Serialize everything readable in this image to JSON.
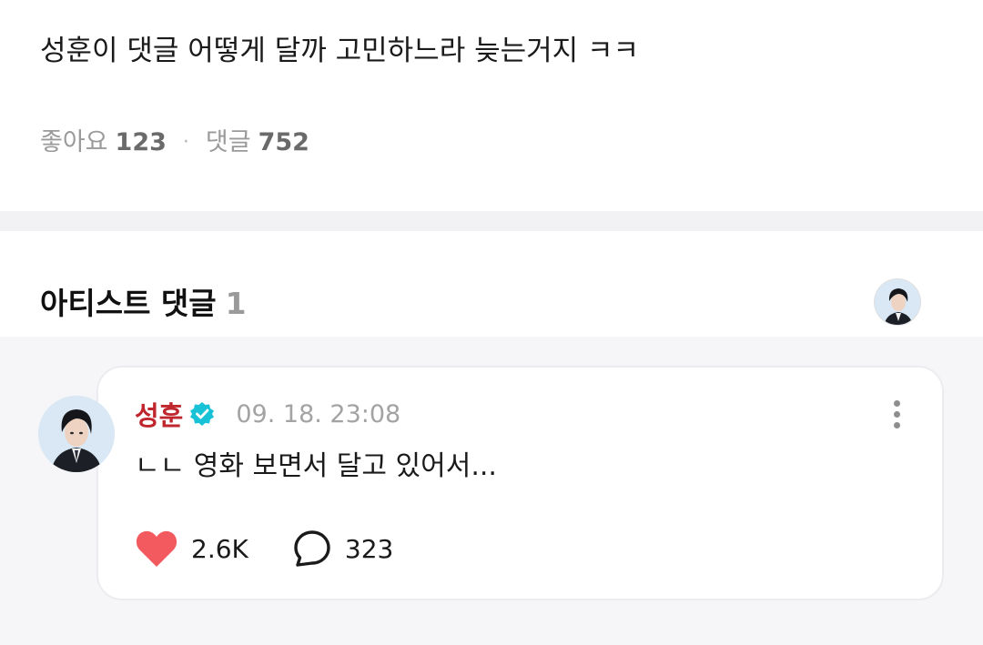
{
  "post": {
    "text": "성훈이 댓글 어떻게 달까 고민하느라 늦는거지 ㅋㅋ",
    "likes_label": "좋아요",
    "likes_count": "123",
    "separator": "·",
    "comments_label": "댓글",
    "comments_count": "752"
  },
  "artist_comments": {
    "title": "아티스트 댓글",
    "count": "1"
  },
  "comment": {
    "author": "성훈",
    "timestamp": "09. 18. 23:08",
    "text": "ㄴㄴ 영화 보면서 달고 있어서...",
    "like_count": "2.6K",
    "reply_count": "323"
  },
  "icons": {
    "verified": "verified-badge-icon",
    "more": "more-vertical-icon",
    "like": "heart-icon",
    "reply": "speech-bubble-icon"
  },
  "colors": {
    "author": "#c0262d",
    "heart": "#f25a5f",
    "verified": "#18c2d6",
    "muted": "#9a9a9a"
  }
}
